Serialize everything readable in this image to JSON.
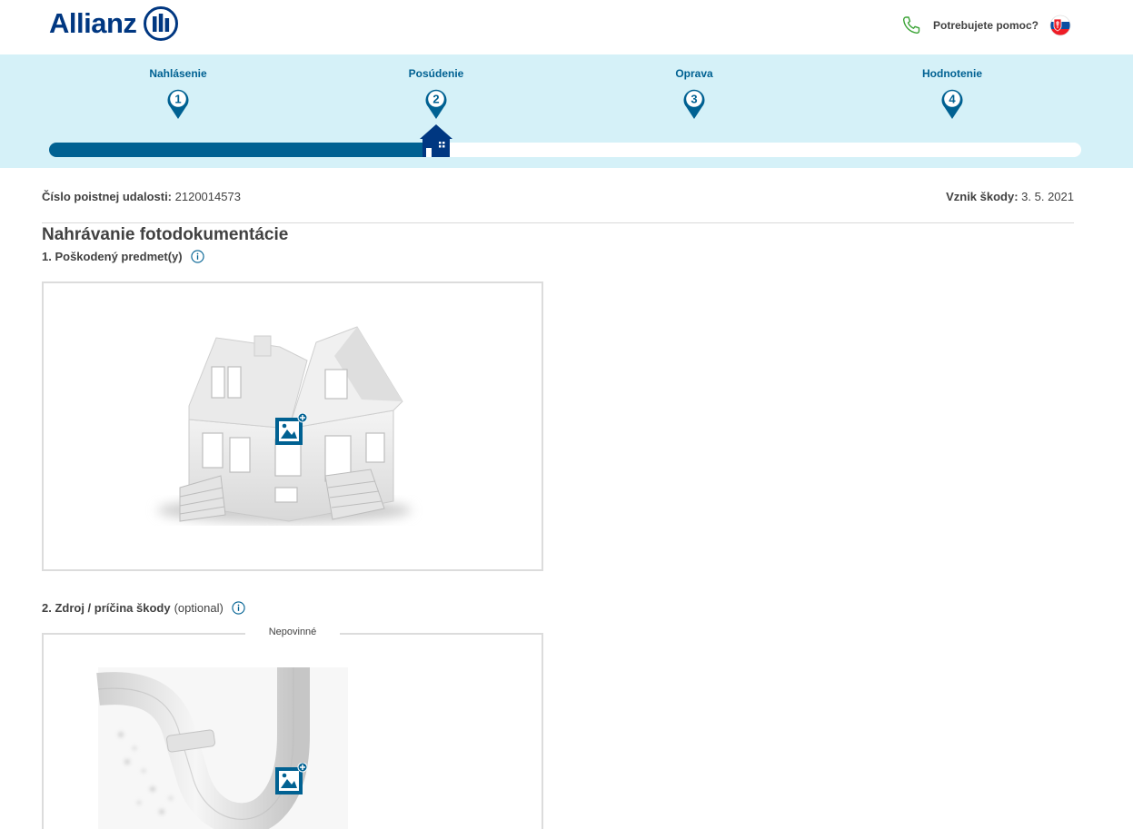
{
  "header": {
    "logo_text": "Allianz",
    "help_text": "Potrebujete pomoc?",
    "brand_color": "#003781"
  },
  "progress": {
    "steps": [
      {
        "label": "Nahlásenie",
        "number": "1"
      },
      {
        "label": "Posúdenie",
        "number": "2"
      },
      {
        "label": "Oprava",
        "number": "3"
      },
      {
        "label": "Hodnotenie",
        "number": "4"
      }
    ],
    "current_step": 2,
    "completion": 0.375,
    "accent_color": "#006192",
    "band_color": "#d5f1f8"
  },
  "claim": {
    "number_label": "Číslo poistnej udalosti:",
    "number_value": "2120014573",
    "date_label": "Vznik škody:",
    "date_value": "3. 5. 2021"
  },
  "page_title": "Nahrávanie fotodokumentácie",
  "sections": [
    {
      "title": "1. Poškodený predmet(y)",
      "optional": ""
    },
    {
      "title": "2. Zdroj / príčina škody",
      "optional": "(optional)",
      "badge": "Nepovinné"
    }
  ],
  "icons": [
    "allianz-logo-icon",
    "phone-icon",
    "slovak-flag-icon",
    "step-pin-icon",
    "house-marker-icon",
    "info-icon",
    "add-photo-icon"
  ]
}
